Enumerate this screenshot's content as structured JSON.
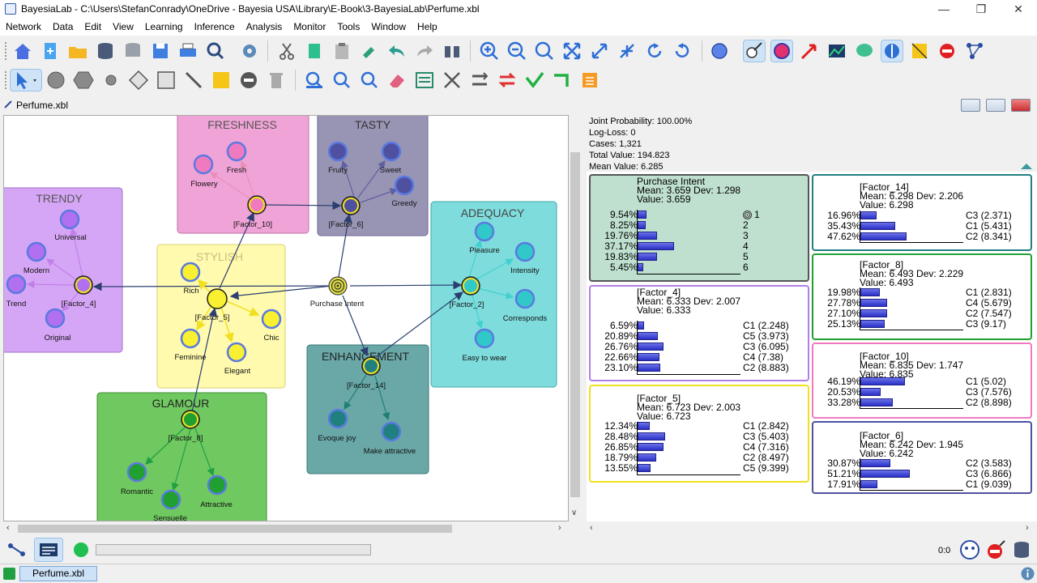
{
  "window": {
    "title": "BayesiaLab - C:\\Users\\StefanConradу\\OneDrive - Bayesia USA\\Library\\E-Book\\3-BayesiaLab\\Perfume.xbl"
  },
  "menu": [
    "Network",
    "Data",
    "Edit",
    "View",
    "Learning",
    "Inference",
    "Analysis",
    "Monitor",
    "Tools",
    "Window",
    "Help"
  ],
  "document": {
    "title": "Perfume.xbl"
  },
  "info": {
    "joint_probability": "Joint Probability: 100.00%",
    "log_loss": "Log-Loss: 0",
    "cases": "Cases: 1,321",
    "total_value": "Total Value: 194.823",
    "mean_value": "Mean Value: 6.285"
  },
  "graph": {
    "clusters": [
      {
        "label": "FRESHNESS",
        "color": "#f0a3d6"
      },
      {
        "label": "TASTY",
        "color": "#9894b4"
      },
      {
        "label": "TRENDY",
        "color": "#d6a6f6"
      },
      {
        "label": "STYLISH",
        "color": "#fffaae"
      },
      {
        "label": "ADEQUACY",
        "color": "#7fdcdc"
      },
      {
        "label": "ENHANCEMENT",
        "color": "#6aa8a8"
      },
      {
        "label": "GLAMOUR",
        "color": "#70c860"
      }
    ],
    "nodes": [
      "Flowery",
      "Fresh",
      "[Factor_10]",
      "Fruity",
      "Sweet",
      "Greedy",
      "[Factor_6]",
      "Universal",
      "Modern",
      "Trend",
      "[Factor_4]",
      "Original",
      "Rich",
      "[Factor_5]",
      "Chic",
      "Feminine",
      "Elegant",
      "Purchase Intent",
      "Pleasure",
      "Intensity",
      "[Factor_2]",
      "Corresponds",
      "Easy to wear",
      "[Factor_14]",
      "Evoque joy",
      "Make attractive",
      "[Factor_8]",
      "Romantic",
      "Sensuelle",
      "Attractive"
    ]
  },
  "monitors": {
    "purchase": {
      "title": "Purchase Intent",
      "mean": "Mean: 3.659  Dev: 1.298",
      "value": "Value: 3.659",
      "rows": [
        {
          "p": "9.54%",
          "v": 9.54,
          "s": "1"
        },
        {
          "p": "8.25%",
          "v": 8.25,
          "s": "2"
        },
        {
          "p": "19.76%",
          "v": 19.76,
          "s": "3"
        },
        {
          "p": "37.17%",
          "v": 37.17,
          "s": "4"
        },
        {
          "p": "19.83%",
          "v": 19.83,
          "s": "5"
        },
        {
          "p": "5.45%",
          "v": 5.45,
          "s": "6"
        }
      ]
    },
    "f4": {
      "title": "[Factor_4]",
      "mean": "Mean: 6.333  Dev: 2.007",
      "value": "Value: 6.333",
      "rows": [
        {
          "p": "6.59%",
          "v": 6.59,
          "s": "C1 (2.248)"
        },
        {
          "p": "20.89%",
          "v": 20.89,
          "s": "C5 (3.973)"
        },
        {
          "p": "26.76%",
          "v": 26.76,
          "s": "C3 (6.095)"
        },
        {
          "p": "22.66%",
          "v": 22.66,
          "s": "C4 (7.38)"
        },
        {
          "p": "23.10%",
          "v": 23.1,
          "s": "C2 (8.883)"
        }
      ]
    },
    "f5": {
      "title": "[Factor_5]",
      "mean": "Mean: 6.723  Dev: 2.003",
      "value": "Value: 6.723",
      "rows": [
        {
          "p": "12.34%",
          "v": 12.34,
          "s": "C1 (2.842)"
        },
        {
          "p": "28.48%",
          "v": 28.48,
          "s": "C3 (5.403)"
        },
        {
          "p": "26.85%",
          "v": 26.85,
          "s": "C4 (7.316)"
        },
        {
          "p": "18.79%",
          "v": 18.79,
          "s": "C2 (8.497)"
        },
        {
          "p": "13.55%",
          "v": 13.55,
          "s": "C5 (9.399)"
        }
      ]
    },
    "f14": {
      "title": "[Factor_14]",
      "mean": "Mean: 6.298  Dev: 2.206",
      "value": "Value: 6.298",
      "rows": [
        {
          "p": "16.96%",
          "v": 16.96,
          "s": "C3 (2.371)"
        },
        {
          "p": "35.43%",
          "v": 35.43,
          "s": "C1 (5.431)"
        },
        {
          "p": "47.62%",
          "v": 47.62,
          "s": "C2 (8.341)"
        }
      ]
    },
    "f8": {
      "title": "[Factor_8]",
      "mean": "Mean: 6.493  Dev: 2.229",
      "value": "Value: 6.493",
      "rows": [
        {
          "p": "19.98%",
          "v": 19.98,
          "s": "C1 (2.831)"
        },
        {
          "p": "27.78%",
          "v": 27.78,
          "s": "C4 (5.679)"
        },
        {
          "p": "27.10%",
          "v": 27.1,
          "s": "C2 (7.547)"
        },
        {
          "p": "25.13%",
          "v": 25.13,
          "s": "C3 (9.17)"
        }
      ]
    },
    "f10": {
      "title": "[Factor_10]",
      "mean": "Mean: 6.835  Dev: 1.747",
      "value": "Value: 6.835",
      "rows": [
        {
          "p": "46.19%",
          "v": 46.19,
          "s": "C1 (5.02)"
        },
        {
          "p": "20.53%",
          "v": 20.53,
          "s": "C3 (7.576)"
        },
        {
          "p": "33.28%",
          "v": 33.28,
          "s": "C2 (8.898)"
        }
      ]
    },
    "f6": {
      "title": "[Factor_6]",
      "mean": "Mean: 6.242  Dev: 1.945",
      "value": "Value: 6.242",
      "rows": [
        {
          "p": "30.87%",
          "v": 30.87,
          "s": "C2 (3.583)"
        },
        {
          "p": "51.21%",
          "v": 51.21,
          "s": "C3 (6.866)"
        },
        {
          "p": "17.91%",
          "v": 17.91,
          "s": "C1 (9.039)"
        }
      ]
    }
  },
  "status": {
    "zoom_counter": "0:0",
    "taskbar_tab": "Perfume.xbl"
  }
}
